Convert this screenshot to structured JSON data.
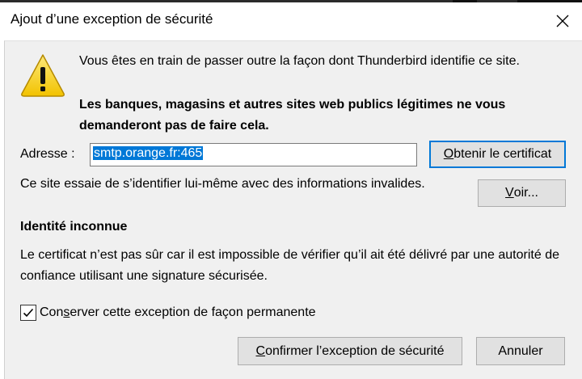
{
  "window": {
    "title": "Ajout d’une exception de sécurité",
    "close_icon": "close-icon"
  },
  "dialog": {
    "warning_icon": "warning-triangle-icon",
    "intro_text": "Vous êtes en train de passer outre la façon dont Thunderbird identifie ce site.",
    "warning_text": "Les banques, magasins et autres sites web publics légitimes ne vous demanderont pas de faire cela.",
    "address": {
      "label": "Adresse :",
      "value": "smtp.orange.fr:465"
    },
    "get_certificate_button": {
      "prefix": "",
      "accesskey": "O",
      "rest": "btenir le certificat"
    },
    "invalid_text": "Ce site essaie de s’identifier lui-même avec des informations invalides.",
    "view_button": {
      "accesskey": "V",
      "rest": "oir..."
    },
    "identity_heading": "Identité inconnue",
    "identity_text": "Le certificat n’est pas sûr car il est impossible de vérifier qu’il ait été délivré par une autorité de confiance utilisant une signature sécurisée.",
    "permanent": {
      "checked": true,
      "label_prefix": "Con",
      "accesskey": "s",
      "label_rest": "erver cette exception de façon permanente"
    },
    "confirm_button": {
      "accesskey": "C",
      "rest": "onfirmer l’exception de sécurité"
    },
    "cancel_button": "Annuler"
  },
  "colors": {
    "accent": "#0078d7",
    "dialog_bg": "#f0f0f0",
    "warning_yellow": "#f7d117"
  }
}
